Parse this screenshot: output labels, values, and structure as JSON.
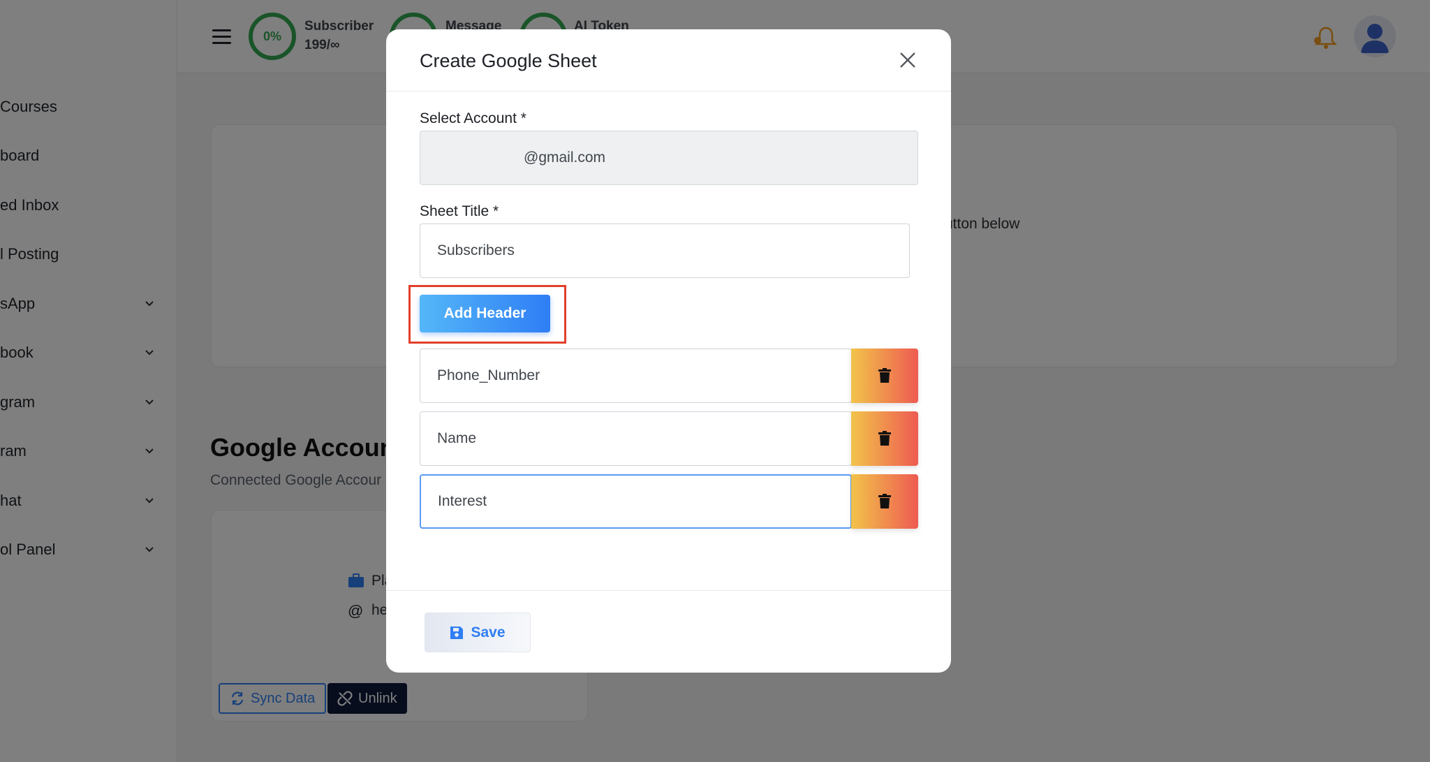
{
  "sidebar": {
    "items": [
      {
        "label": "Courses"
      },
      {
        "label": "board"
      },
      {
        "label": "ed Inbox"
      },
      {
        "label": "l Posting"
      },
      {
        "label": "sApp"
      },
      {
        "label": "book"
      },
      {
        "label": "gram"
      },
      {
        "label": "ram"
      },
      {
        "label": "hat"
      },
      {
        "label": "ol Panel"
      }
    ]
  },
  "topbar": {
    "gauge1": {
      "percent_text": "0%",
      "label": "Subscriber",
      "value": "199/∞"
    },
    "gauge2": {
      "label": "Message"
    },
    "gauge3": {
      "label": "AI Token"
    }
  },
  "background": {
    "card_text": "utton below",
    "heading": "Google Accoun",
    "subtext": "Connected Google Accour",
    "account_line1": "Pla",
    "account_line2": "he",
    "sync_label": "Sync Data",
    "unlink_label": "Unlink"
  },
  "modal": {
    "title": "Create Google Sheet",
    "select_account_label": "Select Account *",
    "select_account_value": "@gmail.com",
    "sheet_title_label": "Sheet Title *",
    "sheet_title_value": "Subscribers",
    "add_header_label": "Add Header",
    "headers": [
      {
        "value": "Phone_Number"
      },
      {
        "value": "Name"
      },
      {
        "value": "Interest"
      }
    ],
    "save_label": "Save"
  },
  "colors": {
    "primary_blue": "#2f7ef5",
    "gauge_green": "#35a853",
    "delete_gradient": [
      "#f2c34a",
      "#ee5b52"
    ],
    "highlight_red": "#e2402c",
    "unlink_navy": "#0e1a3a"
  }
}
